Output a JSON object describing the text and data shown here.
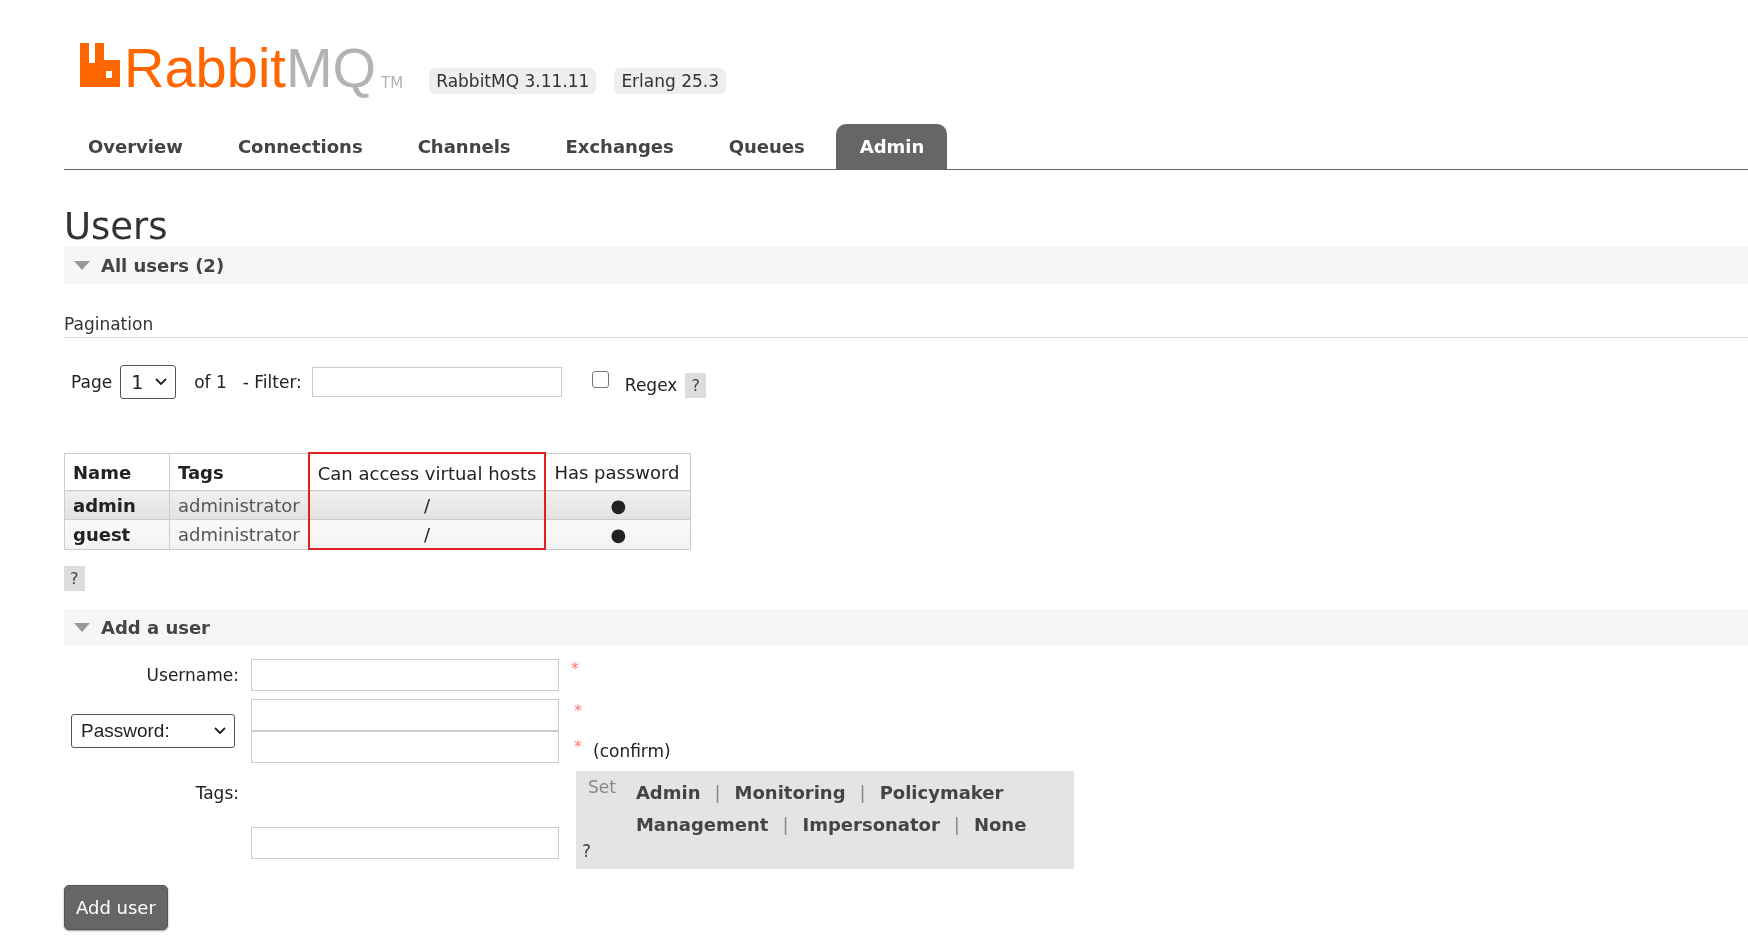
{
  "logo": {
    "part_1": "Rabbit",
    "part_2": "MQ",
    "trademark": "TM"
  },
  "versions": [
    "RabbitMQ 3.11.11",
    "Erlang 25.3"
  ],
  "tabs": [
    {
      "label": "Overview",
      "selected": false
    },
    {
      "label": "Connections",
      "selected": false
    },
    {
      "label": "Channels",
      "selected": false
    },
    {
      "label": "Exchanges",
      "selected": false
    },
    {
      "label": "Queues",
      "selected": false
    },
    {
      "label": "Admin",
      "selected": true
    }
  ],
  "page_title": "Users",
  "all_users": {
    "title": "All users (2)",
    "expanded": true,
    "pagination": {
      "heading": "Pagination",
      "page_label": "Page",
      "page_value": "1",
      "of_label": "of 1",
      "filter_label": "- Filter:",
      "regex_label": "Regex",
      "regex_checked": false,
      "help": "?"
    },
    "table": {
      "columns": [
        {
          "label": "Name",
          "bold": true,
          "highlighted": false
        },
        {
          "label": "Tags",
          "bold": true,
          "highlighted": false
        },
        {
          "label": "Can access virtual hosts",
          "bold": false,
          "highlighted": true
        },
        {
          "label": "Has password",
          "bold": false,
          "highlighted": false
        }
      ],
      "rows": [
        {
          "name": "admin",
          "tags": "administrator",
          "vhosts": "/",
          "has_password": "●"
        },
        {
          "name": "guest",
          "tags": "administrator",
          "vhosts": "/",
          "has_password": "●"
        }
      ]
    },
    "help": "?"
  },
  "add_user": {
    "title": "Add a user",
    "expanded": true,
    "username_label": "Username:",
    "password_mode": "Password:",
    "required_mark": "*",
    "confirm_label": "(confirm)",
    "tags_label": "Tags:",
    "set_label": "Set",
    "separator": "|",
    "tag_shortcuts": [
      [
        "Admin",
        "Monitoring",
        "Policymaker"
      ],
      [
        "Management",
        "Impersonator",
        "None"
      ]
    ],
    "tags_help": "?",
    "submit": "Add user"
  }
}
